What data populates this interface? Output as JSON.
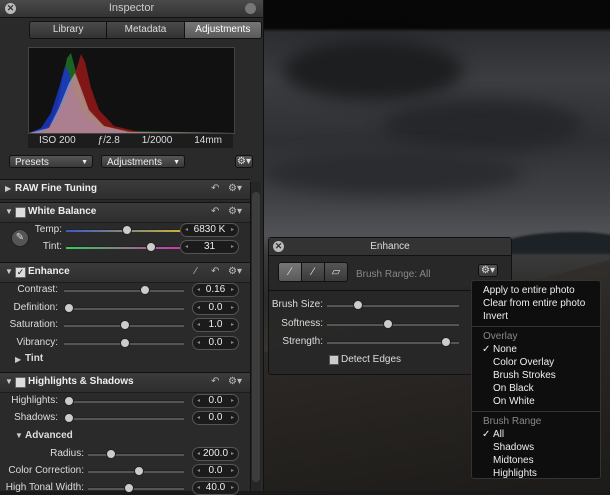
{
  "inspector": {
    "title": "Inspector",
    "tabs": [
      "Library",
      "Metadata",
      "Adjustments"
    ],
    "active_tab": "Adjustments",
    "exif": {
      "iso": "ISO 200",
      "aperture": "ƒ/2.8",
      "shutter": "1/2000",
      "focal": "14mm"
    },
    "presets_label": "Presets",
    "adjustments_label": "Adjustments"
  },
  "raw": {
    "label": "RAW Fine Tuning"
  },
  "white_balance": {
    "label": "White Balance",
    "temp_label": "Temp:",
    "temp_value": "6830 K",
    "tint_label": "Tint:",
    "tint_value": "31"
  },
  "enhance": {
    "label": "Enhance",
    "contrast_label": "Contrast:",
    "contrast_value": "0.16",
    "definition_label": "Definition:",
    "definition_value": "0.0",
    "saturation_label": "Saturation:",
    "saturation_value": "1.0",
    "vibrancy_label": "Vibrancy:",
    "vibrancy_value": "0.0",
    "tint_label": "Tint"
  },
  "highlights_shadows": {
    "label": "Highlights & Shadows",
    "highlights_label": "Highlights:",
    "highlights_value": "0.0",
    "shadows_label": "Shadows:",
    "shadows_value": "0.0",
    "advanced_label": "Advanced",
    "radius_label": "Radius:",
    "radius_value": "200.0",
    "color_correction_label": "Color Correction:",
    "color_correction_value": "0.0",
    "high_tonal_label": "High Tonal Width:",
    "high_tonal_value": "40.0"
  },
  "hud": {
    "title": "Enhance",
    "brush_range": "Brush Range: All",
    "brush_size_label": "Brush Size:",
    "softness_label": "Softness:",
    "strength_label": "Strength:",
    "detect_edges_label": "Detect Edges"
  },
  "menu": {
    "apply_entire": "Apply to entire photo",
    "clear_entire": "Clear from entire photo",
    "invert": "Invert",
    "overlay_header": "Overlay",
    "overlay_items": [
      "None",
      "Color Overlay",
      "Brush Strokes",
      "On Black",
      "On White"
    ],
    "brush_range_header": "Brush Range",
    "range_items": [
      "All",
      "Shadows",
      "Midtones",
      "Highlights"
    ],
    "check": "✓"
  }
}
